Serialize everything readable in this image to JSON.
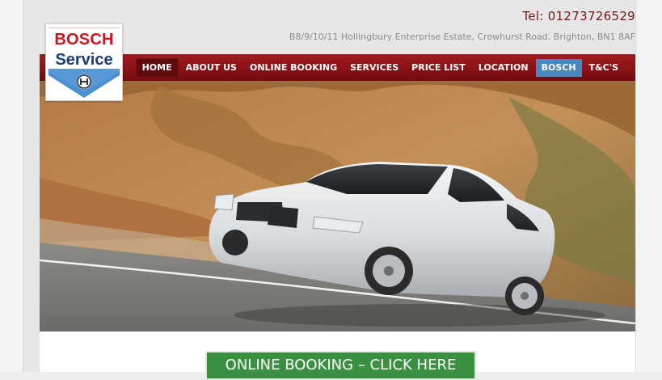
{
  "header": {
    "phone": "Tel: 01273726529",
    "address": "B8/9/10/11 Hollingbury Enterprise Estate, Crowhurst Road. Brighton, BN1 8AF"
  },
  "logo": {
    "line1": "BOSCH",
    "line2": "Service",
    "icon": "bosch-armature-icon"
  },
  "nav": {
    "items": [
      {
        "label": "HOME",
        "state": "active"
      },
      {
        "label": "ABOUT US"
      },
      {
        "label": "ONLINE BOOKING"
      },
      {
        "label": "SERVICES"
      },
      {
        "label": "PRICE LIST"
      },
      {
        "label": "LOCATION"
      },
      {
        "label": "BOSCH",
        "state": "highlight"
      },
      {
        "label": "T&C'S"
      }
    ]
  },
  "hero": {
    "image": "white-luxury-sedan-on-mountain-road"
  },
  "cta": {
    "label": "ONLINE BOOKING – CLICK HERE"
  },
  "colors": {
    "nav_red": "#8a1216",
    "phone_text": "#7a1416",
    "nav_active": "#5e0a0d",
    "nav_highlight": "#4a86c0",
    "cta_green": "#399040",
    "logo_red": "#d0141b",
    "logo_blue": "#1a3d7c"
  }
}
